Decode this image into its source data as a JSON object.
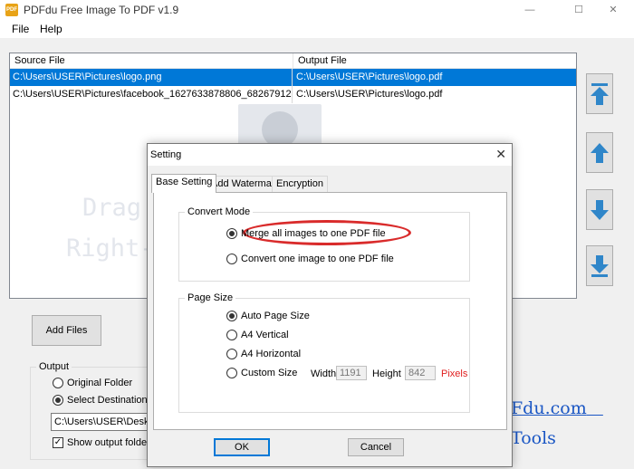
{
  "window": {
    "title": "PDFdu Free Image To PDF  v1.9",
    "icon_text": "PDF"
  },
  "menu": [
    "File",
    "Help"
  ],
  "file_list": {
    "columns": [
      "Source File",
      "Output File"
    ],
    "rows": [
      {
        "source": "C:\\Users\\USER\\Pictures\\logo.png",
        "output": "C:\\Users\\USER\\Pictures\\logo.pdf",
        "selected": true
      },
      {
        "source": "C:\\Users\\USER\\Pictures\\facebook_1627633878806_682679128841219...",
        "output": "C:\\Users\\USER\\Pictures\\logo.pdf",
        "selected": false
      }
    ],
    "hint_line1": "Drag a",
    "hint_line2": "Right-c"
  },
  "side_buttons": [
    "move-top-icon",
    "move-up-icon",
    "move-down-icon",
    "move-bottom-icon"
  ],
  "add_files_label": "Add Files",
  "output": {
    "title": "Output",
    "original_folder": "Original Folder",
    "destination_folder": "Select Destination Fol",
    "path": "C:\\Users\\USER\\Desktop",
    "show_output": "Show output folder wh"
  },
  "links": [
    "Fdu.com",
    "Tools"
  ],
  "dialog": {
    "title": "Setting",
    "tabs": [
      "Base Setting",
      "Add Watermark",
      "Encryption"
    ],
    "convert_mode": {
      "title": "Convert Mode",
      "options": [
        "Merge all images to one PDF file",
        "Convert one image to one PDF file"
      ],
      "selected": 0
    },
    "page_size": {
      "title": "Page Size",
      "options": [
        "Auto Page Size",
        "A4 Vertical",
        "A4 Horizontal",
        "Custom Size"
      ],
      "selected": 0,
      "width_label": "Width",
      "width_value": "1191",
      "height_label": "Height",
      "height_value": "842",
      "unit": "Pixels"
    },
    "ok": "OK",
    "cancel": "Cancel"
  },
  "colors": {
    "selection": "#0078d7",
    "highlight": "#d92b2b",
    "link": "#1a56c4",
    "arrow": "#2f86c9"
  }
}
